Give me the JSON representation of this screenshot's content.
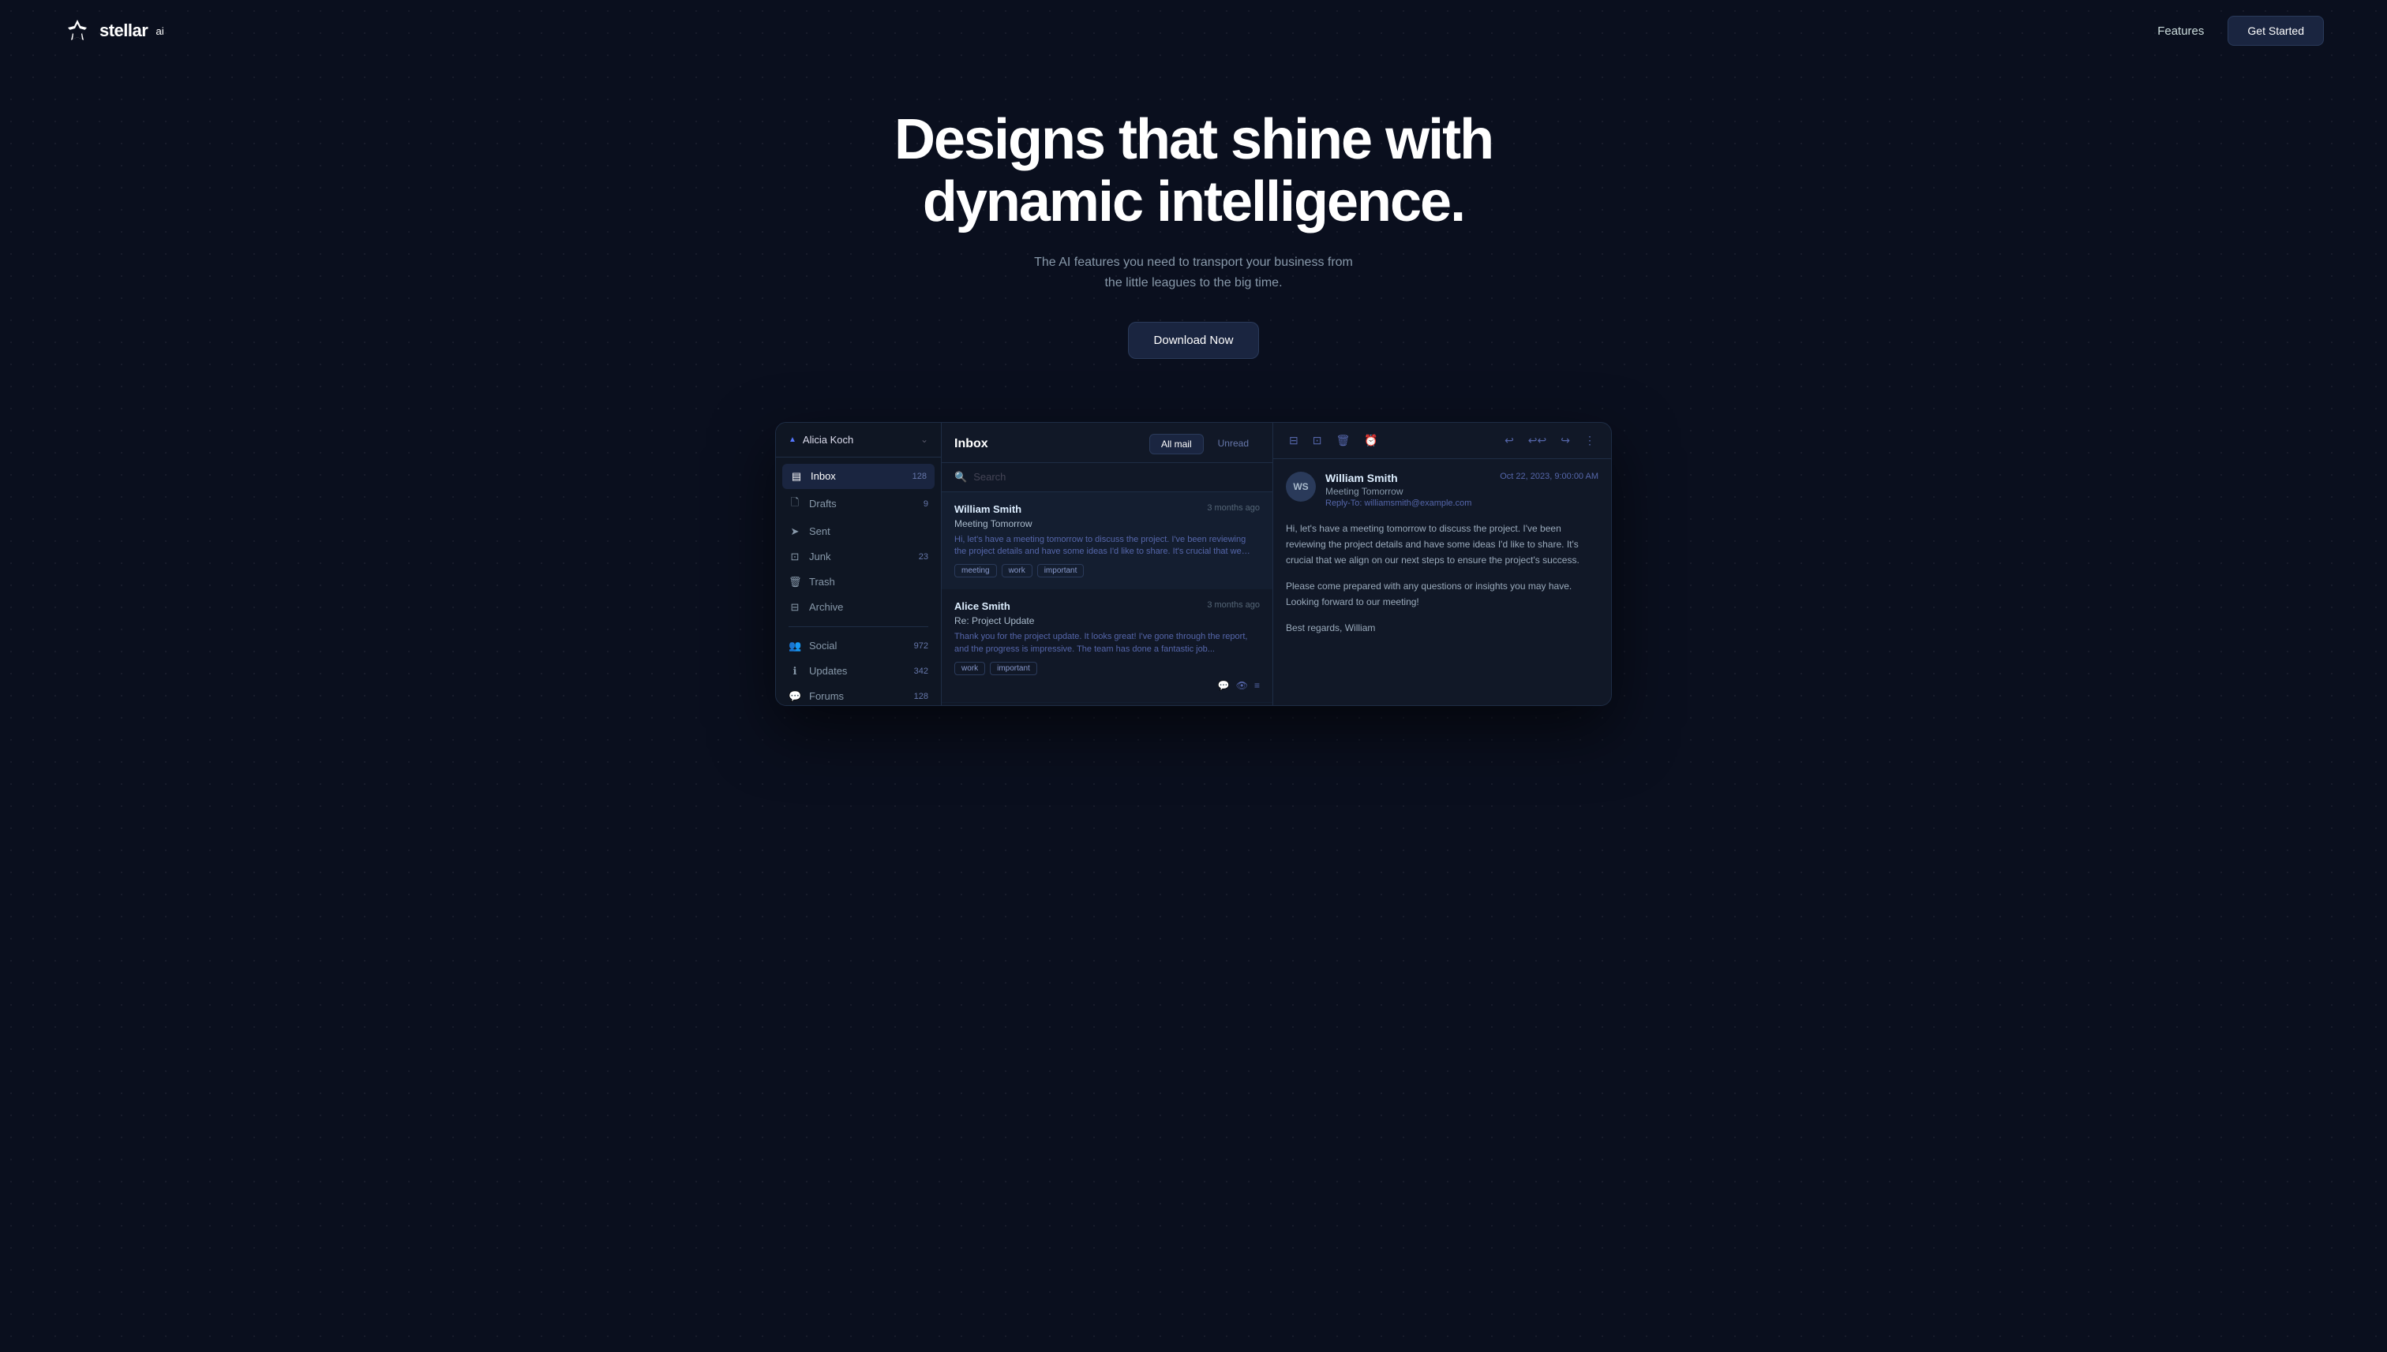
{
  "navbar": {
    "logo_text": "stellar",
    "logo_sup": "ai",
    "features_label": "Features",
    "get_started_label": "Get Started"
  },
  "hero": {
    "title_line1": "Designs that shine with",
    "title_line2": "dynamic intelligence.",
    "subtitle": "The AI features you need to transport your business from the little leagues to the big time.",
    "download_label": "Download Now"
  },
  "app": {
    "sidebar": {
      "user": "Alicia Koch",
      "items": [
        {
          "label": "Inbox",
          "badge": "128",
          "active": true
        },
        {
          "label": "Drafts",
          "badge": "9",
          "active": false
        },
        {
          "label": "Sent",
          "badge": "",
          "active": false
        },
        {
          "label": "Junk",
          "badge": "23",
          "active": false
        },
        {
          "label": "Trash",
          "badge": "",
          "active": false
        },
        {
          "label": "Archive",
          "badge": "",
          "active": false
        },
        {
          "label": "Social",
          "badge": "972",
          "active": false
        },
        {
          "label": "Updates",
          "badge": "342",
          "active": false
        },
        {
          "label": "Forums",
          "badge": "128",
          "active": false
        }
      ]
    },
    "mail_panel": {
      "title": "Inbox",
      "tab_all": "All mail",
      "tab_unread": "Unread",
      "search_placeholder": "Search",
      "emails": [
        {
          "sender": "William Smith",
          "time": "3 months ago",
          "subject": "Meeting Tomorrow",
          "preview": "Hi, let's have a meeting tomorrow to discuss the project. I've been reviewing the project details and have some ideas I'd like to share. It's crucial that we align on our...",
          "tags": [
            "meeting",
            "work",
            "important"
          ],
          "selected": true
        },
        {
          "sender": "Alice Smith",
          "time": "3 months ago",
          "subject": "Re: Project Update",
          "preview": "Thank you for the project update. It looks great! I've gone through the report, and the progress is impressive. The team has done a fantastic job...",
          "tags": [
            "work",
            "important"
          ],
          "selected": false
        }
      ]
    },
    "detail": {
      "avatar_initials": "WS",
      "sender_name": "William Smith",
      "subject": "Meeting Tomorrow",
      "reply_to": "Reply-To: williamsmith@example.com",
      "date": "Oct 22, 2023, 9:00:00 AM",
      "body_p1": "Hi, let's have a meeting tomorrow to discuss the project. I've been reviewing the project details and have some ideas I'd like to share. It's crucial that we align on our next steps to ensure the project's success.",
      "body_p2": "Please come prepared with any questions or insights you may have. Looking forward to our meeting!",
      "body_p3": "Best regards, William"
    }
  }
}
